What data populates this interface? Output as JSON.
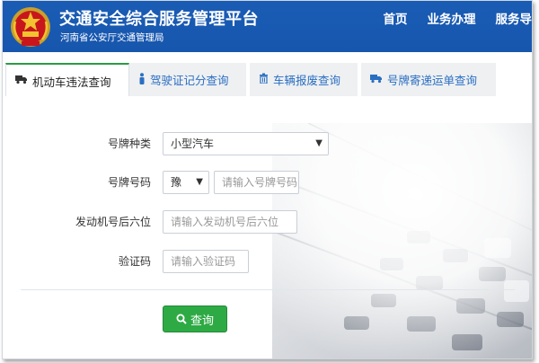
{
  "header": {
    "title": "交通安全综合服务管理平台",
    "subtitle": "河南省公安厅交通管理局",
    "nav": [
      "首页",
      "业务办理",
      "服务导"
    ],
    "brand_color": "#1756ad"
  },
  "tabs": [
    {
      "label": "机动车违法查询",
      "icon": "truck-icon",
      "active": true
    },
    {
      "label": "驾驶证记分查询",
      "icon": "person-icon",
      "active": false
    },
    {
      "label": "车辆报废查询",
      "icon": "trash-icon",
      "active": false
    },
    {
      "label": "号牌寄递运单查询",
      "icon": "truck-icon",
      "active": false
    }
  ],
  "form": {
    "plate_type": {
      "label": "号牌种类",
      "value": "小型汽车"
    },
    "plate_number": {
      "label": "号牌号码",
      "prefix": "豫",
      "placeholder": "请输入号牌号码"
    },
    "engine": {
      "label": "发动机号后六位",
      "placeholder": "请输入发动机号后六位"
    },
    "captcha": {
      "label": "验证码",
      "placeholder": "请输入验证码"
    },
    "search_label": "查询"
  },
  "colors": {
    "accent_green": "#2eaa45",
    "tab_link": "#2a6ec2"
  }
}
